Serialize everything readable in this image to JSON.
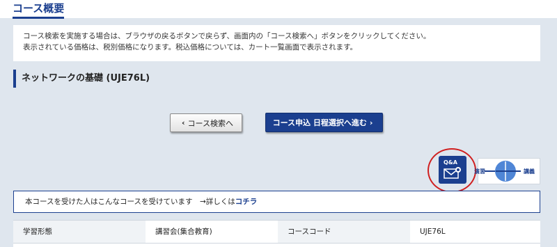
{
  "header": {
    "title": "コース概要"
  },
  "notice": {
    "line1": "コース検索を実施する場合は、ブラウザの戻るボタンで戻らず、画面内の「コース検索へ」ボタンをクリックしてください。",
    "line2": "表示されている価格は、税別価格になります。税込価格については、カート一覧画面で表示されます。"
  },
  "course": {
    "title": "ネットワークの基礎 (UJE76L)"
  },
  "buttons": {
    "back_label": "コース検索へ",
    "apply_label": "コース申込 日程選択へ進む"
  },
  "qa": {
    "label": "Q&A"
  },
  "flow": {
    "label_start": "演習",
    "label_end": "講義"
  },
  "recommend": {
    "text": "本コースを受けた人はこんなコースを受けています　→詳しくは",
    "link": "コチラ"
  },
  "table": {
    "rows": [
      {
        "label1": "学習形態",
        "value1": "講習会(集合教育)",
        "label2": "コースコード",
        "value2": "UJE76L"
      }
    ]
  },
  "colors": {
    "accent": "#1b3f8f",
    "background": "#dfe6ee",
    "highlight_circle": "#d01f1f"
  }
}
